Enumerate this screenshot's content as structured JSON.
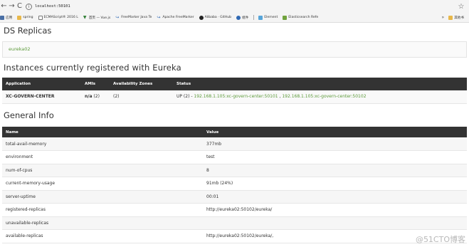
{
  "browser": {
    "back_icon": "←",
    "forward_icon": "→",
    "reload_icon": "C",
    "info_icon": "i",
    "url": "localhost:50101",
    "star_icon": "☆",
    "bookmarks": [
      {
        "label": "应用",
        "kind": "apps"
      },
      {
        "label": "spring",
        "kind": "folder"
      },
      {
        "label": "ECMAScript® 2016 L",
        "kind": "doc"
      },
      {
        "label": "首页 — Vue.js",
        "kind": "v",
        "glyph": "▼"
      },
      {
        "label": "FreeMarker Java Te",
        "kind": "arrow",
        "glyph": "↪"
      },
      {
        "label": "Apache FreeMarker",
        "kind": "arrow",
        "glyph": "↪"
      },
      {
        "label": "Alibaba · GitHub",
        "kind": "gh"
      },
      {
        "label": "组件",
        "kind": "e"
      },
      {
        "label": "Element",
        "kind": "el"
      },
      {
        "label": "Elasticsearch Refe",
        "kind": "es"
      }
    ],
    "more_label": "»",
    "other_bookmarks": "其他书"
  },
  "ds_replicas": {
    "title": "DS Replicas",
    "replica": "eureka02"
  },
  "instances": {
    "title": "Instances currently registered with Eureka",
    "headers": [
      "Application",
      "AMIs",
      "Availability Zones",
      "Status"
    ],
    "rows": [
      {
        "application": "XC-GOVERN-CENTER",
        "amis_bold": "n/a",
        "amis_count": " (2)",
        "zones": "(2)",
        "status_prefix": "UP (2) - ",
        "status_link1": "192.168.1.105:xc-govern-center:50101",
        "status_sep": " , ",
        "status_link2": "192.168.1.105:xc-govern-center:50102"
      }
    ]
  },
  "general_info": {
    "title": "General Info",
    "headers": [
      "Name",
      "Value"
    ],
    "rows": [
      {
        "name": "total-avail-memory",
        "value": "377mb"
      },
      {
        "name": "environment",
        "value": "test"
      },
      {
        "name": "num-of-cpus",
        "value": "8"
      },
      {
        "name": "current-memory-usage",
        "value": "91mb (24%)"
      },
      {
        "name": "server-uptime",
        "value": "00:01"
      },
      {
        "name": "registered-replicas",
        "value": "http://eureka02:50102/eureka/"
      },
      {
        "name": "unavailable-replicas",
        "value": ""
      },
      {
        "name": "available-replicas",
        "value": "http://eureka02:50102/eureka/,"
      }
    ]
  },
  "watermark": "@51CTO博客"
}
